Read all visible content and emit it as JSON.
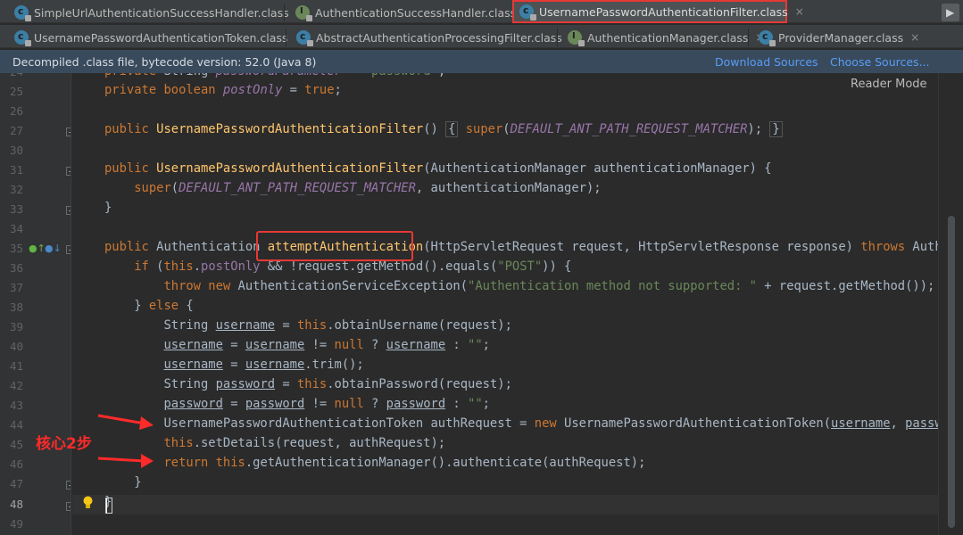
{
  "tabs_row1": [
    {
      "label": "SimpleUrlAuthenticationSuccessHandler.class",
      "icon": "class-icon",
      "active": false
    },
    {
      "label": "AuthenticationSuccessHandler.class",
      "icon": "interface-icon",
      "active": false
    },
    {
      "label": "UsernamePasswordAuthenticationFilter.class",
      "icon": "class-icon",
      "active": true
    }
  ],
  "tabs_row2": [
    {
      "label": "UsernamePasswordAuthenticationToken.class",
      "icon": "class-icon"
    },
    {
      "label": "AbstractAuthenticationProcessingFilter.class",
      "icon": "class-icon"
    },
    {
      "label": "AuthenticationManager.class",
      "icon": "interface-icon"
    },
    {
      "label": "ProviderManager.class",
      "icon": "class-icon"
    }
  ],
  "close_glyph": "×",
  "banner": {
    "text": "Decompiled .class file, bytecode version: 52.0 (Java 8)",
    "download": "Download Sources",
    "choose": "Choose Sources..."
  },
  "reader_mode": "Reader Mode",
  "annotation": "核心2步",
  "line_numbers": [
    "24",
    "25",
    "26",
    "27",
    "30",
    "31",
    "32",
    "33",
    "34",
    "35",
    "36",
    "37",
    "38",
    "39",
    "40",
    "41",
    "42",
    "43",
    "44",
    "45",
    "46",
    "47",
    "48",
    "49"
  ],
  "colors": {
    "keyword": "#cc7832",
    "method": "#ffc66d",
    "string": "#6a8759",
    "field": "#9876aa",
    "highlight_box": "#e53935"
  }
}
